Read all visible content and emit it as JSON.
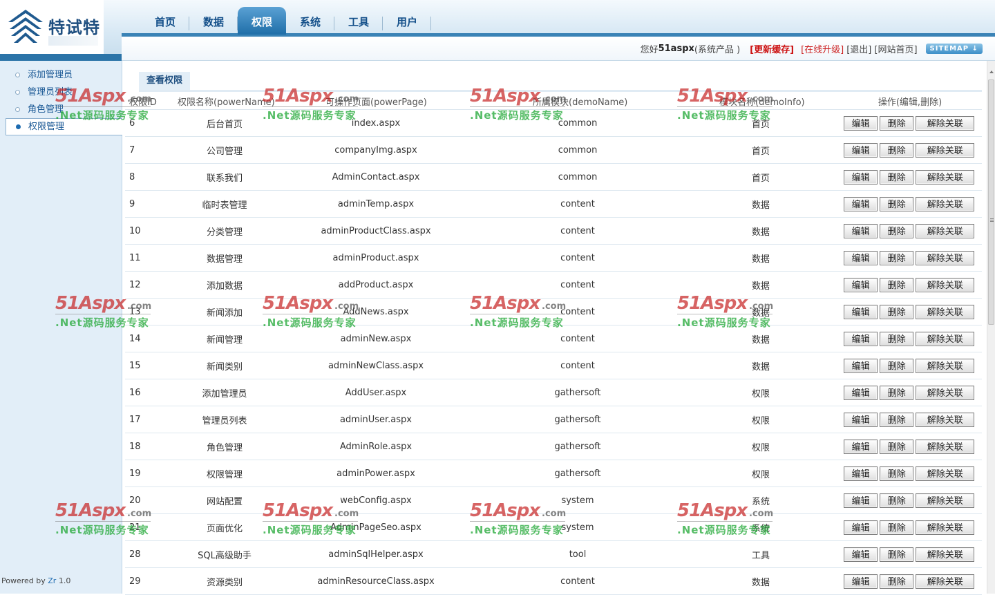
{
  "brand": {
    "name": "特试特"
  },
  "nav": {
    "items": [
      {
        "label": "首页",
        "active": false
      },
      {
        "label": "数据",
        "active": false
      },
      {
        "label": "权限",
        "active": true
      },
      {
        "label": "系统",
        "active": false
      },
      {
        "label": "工具",
        "active": false
      },
      {
        "label": "用户",
        "active": false
      }
    ]
  },
  "topbar": {
    "greeting": "您好",
    "username": "51aspx",
    "role": "(系统产品 )",
    "refresh_cache": "[更新缓存]",
    "upgrade": "[在线升级]",
    "logout": "[退出]",
    "site_home": "[网站首页]",
    "sitemap": "SITEMAP ↓"
  },
  "sidebar": {
    "items": [
      {
        "label": "添加管理员",
        "active": false
      },
      {
        "label": "管理员列表",
        "active": false
      },
      {
        "label": "角色管理",
        "active": false
      },
      {
        "label": "权限管理",
        "active": true
      }
    ],
    "powered_prefix": "Powered by",
    "powered_product": "Zr",
    "powered_version": "1.0"
  },
  "panel": {
    "tab_label": "查看权限",
    "columns": {
      "id": "权限ID",
      "name": "权限名称(powerName)",
      "page": "可操作页面(powerPage)",
      "demo": "所属模块(demoName)",
      "info": "模块名称(demoInfo)",
      "ops": "操作(编辑,删除)"
    },
    "buttons": {
      "edit": "编辑",
      "delete": "删除",
      "unlink": "解除关联"
    },
    "rows": [
      {
        "id": "6",
        "name": "后台首页",
        "page": "index.aspx",
        "demo": "common",
        "info": "首页"
      },
      {
        "id": "7",
        "name": "公司管理",
        "page": "companyImg.aspx",
        "demo": "common",
        "info": "首页"
      },
      {
        "id": "8",
        "name": "联系我们",
        "page": "AdminContact.aspx",
        "demo": "common",
        "info": "首页"
      },
      {
        "id": "9",
        "name": "临时表管理",
        "page": "adminTemp.aspx",
        "demo": "content",
        "info": "数据"
      },
      {
        "id": "10",
        "name": "分类管理",
        "page": "adminProductClass.aspx",
        "demo": "content",
        "info": "数据"
      },
      {
        "id": "11",
        "name": "数据管理",
        "page": "adminProduct.aspx",
        "demo": "content",
        "info": "数据"
      },
      {
        "id": "12",
        "name": "添加数据",
        "page": "addProduct.aspx",
        "demo": "content",
        "info": "数据"
      },
      {
        "id": "13",
        "name": "新闻添加",
        "page": "AddNews.aspx",
        "demo": "content",
        "info": "数据"
      },
      {
        "id": "14",
        "name": "新闻管理",
        "page": "adminNew.aspx",
        "demo": "content",
        "info": "数据"
      },
      {
        "id": "15",
        "name": "新闻类别",
        "page": "adminNewClass.aspx",
        "demo": "content",
        "info": "数据"
      },
      {
        "id": "16",
        "name": "添加管理员",
        "page": "AddUser.aspx",
        "demo": "gathersoft",
        "info": "权限"
      },
      {
        "id": "17",
        "name": "管理员列表",
        "page": "adminUser.aspx",
        "demo": "gathersoft",
        "info": "权限"
      },
      {
        "id": "18",
        "name": "角色管理",
        "page": "AdminRole.aspx",
        "demo": "gathersoft",
        "info": "权限"
      },
      {
        "id": "19",
        "name": "权限管理",
        "page": "adminPower.aspx",
        "demo": "gathersoft",
        "info": "权限"
      },
      {
        "id": "20",
        "name": "网站配置",
        "page": "webConfig.aspx",
        "demo": "system",
        "info": "系统"
      },
      {
        "id": "21",
        "name": "页面优化",
        "page": "AdminPageSeo.aspx",
        "demo": "system",
        "info": "系统"
      },
      {
        "id": "28",
        "name": "SQL高级助手",
        "page": "adminSqlHelper.aspx",
        "demo": "tool",
        "info": "工具"
      },
      {
        "id": "29",
        "name": "资源类别",
        "page": "adminResourceClass.aspx",
        "demo": "content",
        "info": "数据"
      }
    ]
  },
  "watermark": {
    "main": "51Aspx",
    "suffix": ".com",
    "sub": ".Net源码服务专家"
  },
  "colors": {
    "nav_active": "#1f6ea8",
    "link_red": "#cc1111",
    "sidebar_bg": "#e2eef8"
  }
}
